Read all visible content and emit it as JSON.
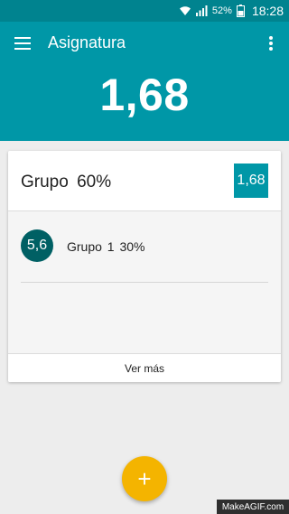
{
  "status_bar": {
    "battery_percent": "52%",
    "time": "18:28",
    "icons": [
      "wifi-icon",
      "signal-icon",
      "battery-icon"
    ]
  },
  "app_bar": {
    "title": "Asignatura",
    "overall_grade": "1,68",
    "menu_icon": "hamburger-menu-icon",
    "overflow_icon": "more-vert-icon"
  },
  "card": {
    "title": "Grupo  60%",
    "grade": "1,68",
    "subjects": [
      {
        "grade": "5,6",
        "label": "Grupo  1 30%"
      }
    ],
    "more_label": "Ver más"
  },
  "fab": {
    "label": "+"
  },
  "watermark": "MakeAGIF.com",
  "colors": {
    "status_bar": "#00838f",
    "app_bar": "#0097a7",
    "grade_box": "#0097a7",
    "subject_circle": "#006064",
    "fab": "#f4b400",
    "background": "#ededed"
  }
}
